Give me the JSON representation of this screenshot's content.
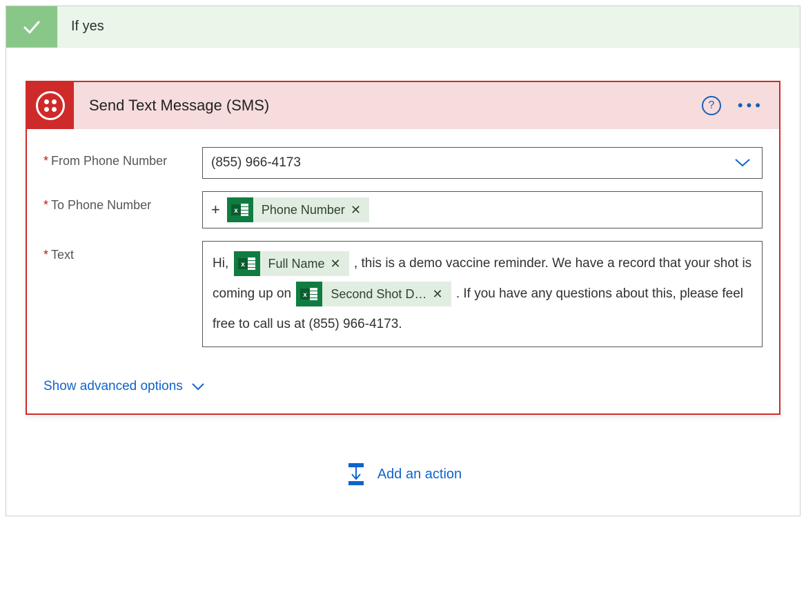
{
  "condition": {
    "title": "If yes"
  },
  "action": {
    "title": "Send Text Message (SMS)",
    "fields": {
      "from": {
        "label": "From Phone Number",
        "value": "(855) 966-4173"
      },
      "to": {
        "label": "To Phone Number",
        "prefix": "+"
      },
      "text": {
        "label": "Text"
      }
    },
    "tokens": {
      "phone": "Phone Number",
      "fullName": "Full Name",
      "secondShot": "Second Shot D…"
    },
    "message": {
      "part1": "Hi,",
      "part2": ", this is a demo vaccine reminder. We have a record that your shot is coming up on",
      "part3": ". If you have any questions about this, please feel free to call us at (855) 966-4173."
    },
    "advancedLabel": "Show advanced options"
  },
  "addAction": "Add an action"
}
